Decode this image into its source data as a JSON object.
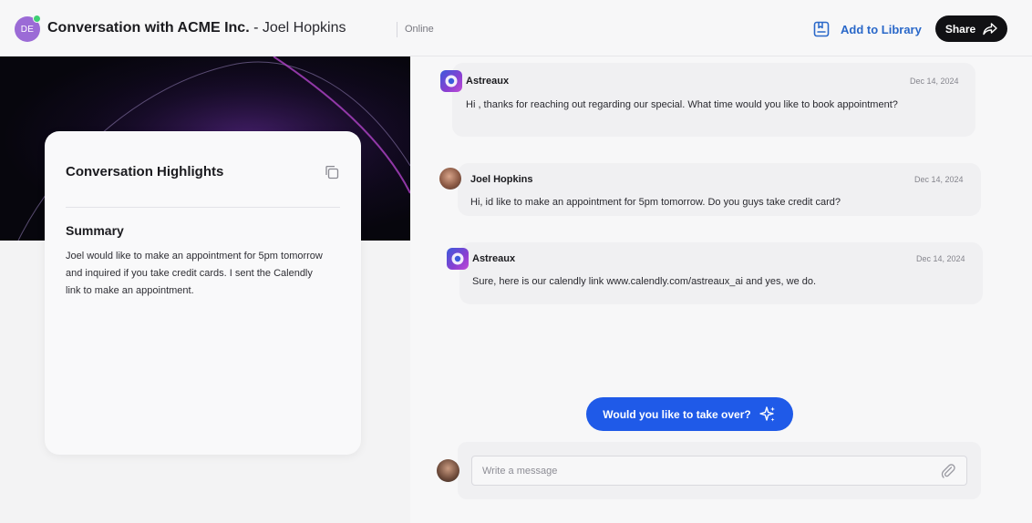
{
  "header": {
    "avatar_initials": "DE",
    "title_main": "Conversation with ACME Inc.",
    "title_separator": " - ",
    "title_person": "Joel Hopkins",
    "status": "Online",
    "library_label": "Add to Library",
    "share_label": "Share",
    "accent_color": "#2a68c9"
  },
  "highlights": {
    "title": "Conversation Highlights",
    "summary_title": "Summary",
    "summary_lines": [
      "Joel would like to make an appointment for 5pm tomorrow",
      "and inquired if you take credit cards. I sent the Calendly",
      "link to make an appointment."
    ]
  },
  "messages": [
    {
      "sender": "Astreaux",
      "date": "Dec 14, 2024",
      "text": "Hi , thanks for reaching out regarding our special. What time would you like to book appointment?",
      "icon": "astreaux-logo-icon"
    },
    {
      "sender": "Joel Hopkins",
      "date": "Dec 14, 2024",
      "text": "Hi, id like to make an appointment for 5pm tomorrow. Do you guys take credit card?",
      "icon": "user-avatar"
    },
    {
      "sender": "Astreaux",
      "date": "Dec 14, 2024",
      "text": "Sure, here is our calendly link www.calendly.com/astreaux_ai and yes, we do.",
      "icon": "astreaux-logo-icon"
    }
  ],
  "takeover": {
    "label": "Would you like to take over?",
    "color": "#1f5ae8"
  },
  "composer": {
    "placeholder": "Write a message",
    "value": ""
  }
}
